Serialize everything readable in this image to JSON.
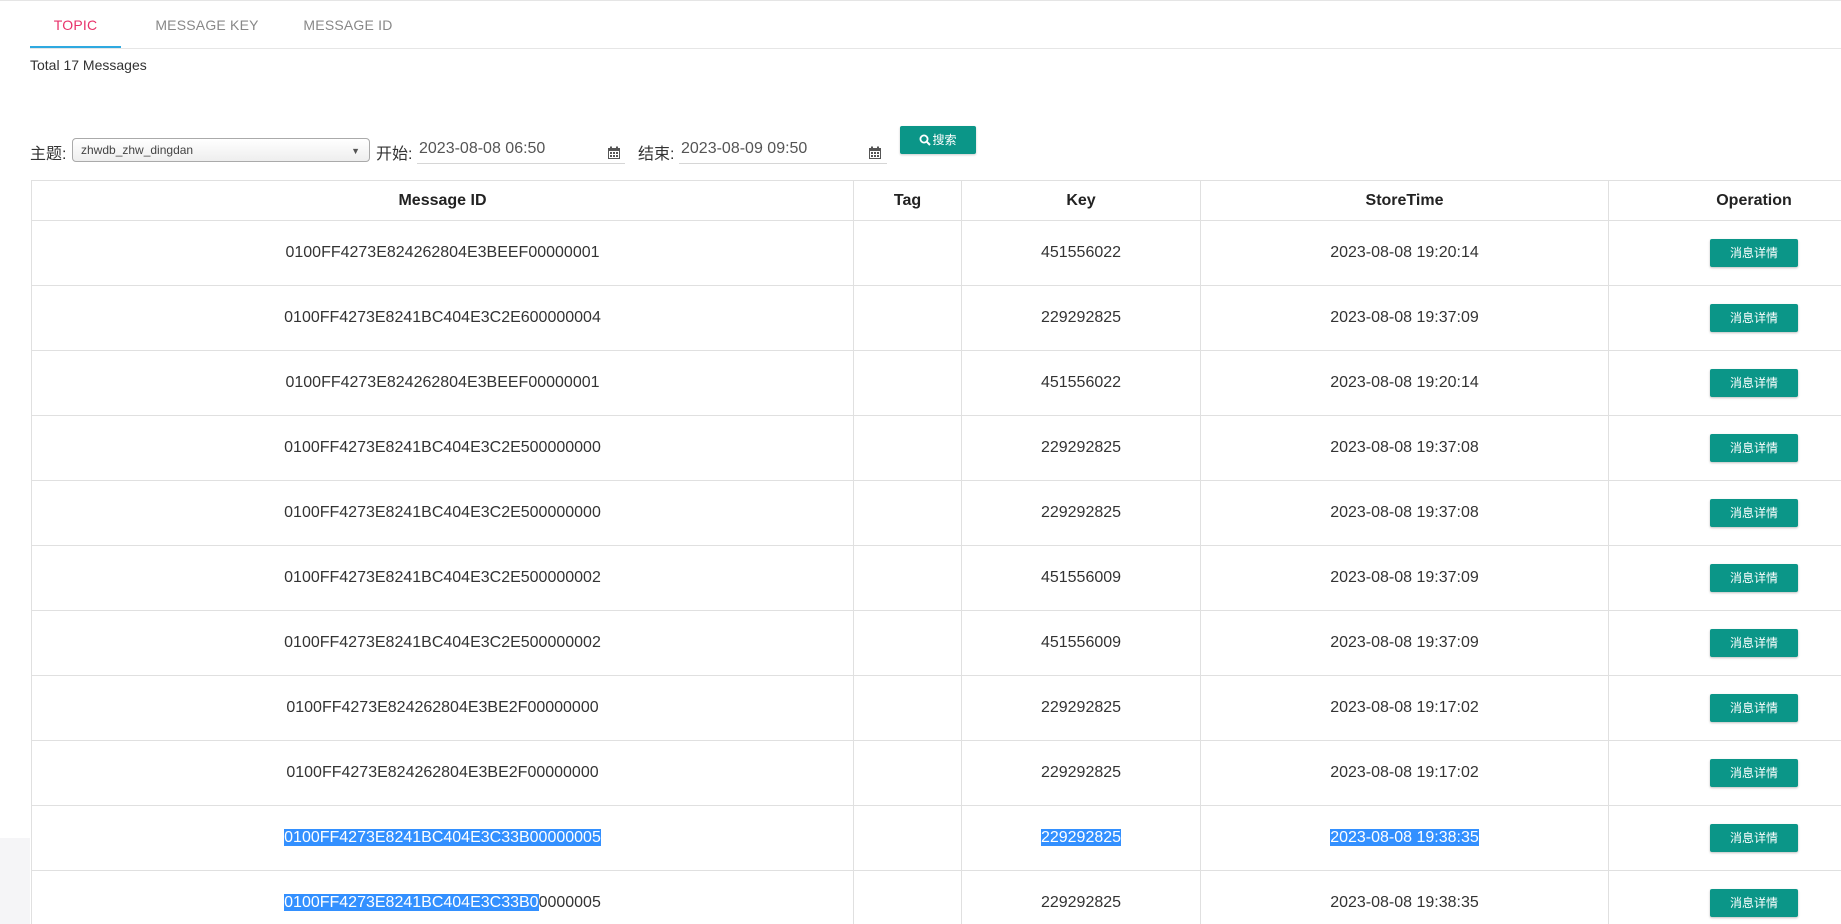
{
  "tabs": [
    {
      "label": "TOPIC",
      "active": true
    },
    {
      "label": "MESSAGE KEY",
      "active": false
    },
    {
      "label": "MESSAGE ID",
      "active": false
    }
  ],
  "summary": "Total 17 Messages",
  "filter": {
    "topic_label": "主题:",
    "topic_value": "zhwdb_zhw_dingdan",
    "start_label": "开始:",
    "start_value": "2023-08-08 06:50",
    "end_label": "结束:",
    "end_value": "2023-08-09 09:50",
    "search_label": "搜索"
  },
  "table": {
    "headers": [
      "Message ID",
      "Tag",
      "Key",
      "StoreTime",
      "Operation"
    ],
    "detail_label": "消息详情",
    "rows": [
      {
        "id": "0100FF4273E824262804E3BEEF00000001",
        "tag": "",
        "key": "451556022",
        "time": "2023-08-08 19:20:14"
      },
      {
        "id": "0100FF4273E8241BC404E3C2E600000004",
        "tag": "",
        "key": "229292825",
        "time": "2023-08-08 19:37:09"
      },
      {
        "id": "0100FF4273E824262804E3BEEF00000001",
        "tag": "",
        "key": "451556022",
        "time": "2023-08-08 19:20:14"
      },
      {
        "id": "0100FF4273E8241BC404E3C2E500000000",
        "tag": "",
        "key": "229292825",
        "time": "2023-08-08 19:37:08"
      },
      {
        "id": "0100FF4273E8241BC404E3C2E500000000",
        "tag": "",
        "key": "229292825",
        "time": "2023-08-08 19:37:08"
      },
      {
        "id": "0100FF4273E8241BC404E3C2E500000002",
        "tag": "",
        "key": "451556009",
        "time": "2023-08-08 19:37:09"
      },
      {
        "id": "0100FF4273E8241BC404E3C2E500000002",
        "tag": "",
        "key": "451556009",
        "time": "2023-08-08 19:37:09"
      },
      {
        "id": "0100FF4273E824262804E3BE2F00000000",
        "tag": "",
        "key": "229292825",
        "time": "2023-08-08 19:17:02"
      },
      {
        "id": "0100FF4273E824262804E3BE2F00000000",
        "tag": "",
        "key": "229292825",
        "time": "2023-08-08 19:17:02"
      },
      {
        "id": "0100FF4273E8241BC404E3C33B00000005",
        "tag": "",
        "key": "229292825",
        "time": "2023-08-08 19:38:35"
      },
      {
        "id_selected": "0100FF4273E8241BC404E3C33B0",
        "id_rest": "0000005",
        "tag": "",
        "key": "229292825",
        "time": "2023-08-08 19:38:35"
      }
    ]
  },
  "colors": {
    "accent": "#0b9688",
    "tab_active_text": "#e8336b",
    "tab_indicator": "#2fa9e0",
    "selection": "#3390ff"
  }
}
